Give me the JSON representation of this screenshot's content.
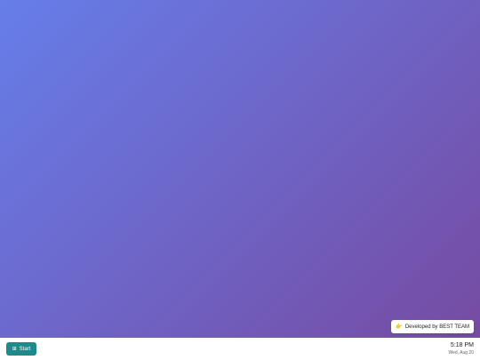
{
  "desktop": {
    "gradient_start": "#667eea",
    "gradient_end": "#764ba2"
  },
  "badge": {
    "icon": "hand-pointing-icon",
    "glyph": "👉",
    "label": "Developed by BEST TEAM"
  },
  "taskbar": {
    "start_icon": "grid-icon",
    "start_glyph": "⊞",
    "start_label": "Start",
    "accent": "#1f8a8a",
    "time": "5:18 PM",
    "date": "Wed, Aug 20"
  }
}
